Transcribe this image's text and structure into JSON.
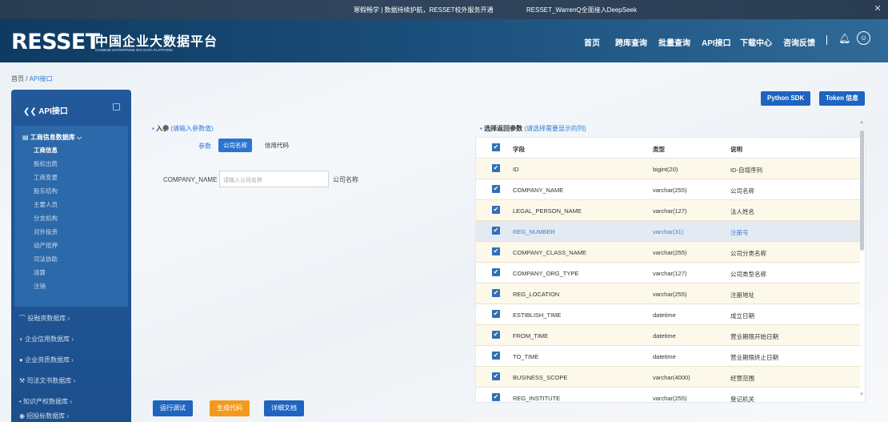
{
  "topbar": {
    "notice": "寒假畅学 | 数据持续护航，RESSET校外服务开通",
    "notice2": "RESSET_WarrenQ全面接入DeepSeek",
    "close": "✕"
  },
  "header": {
    "logo": "RESSET",
    "title_cn": "中国企业大数据平台",
    "title_en": "CHINESE ENTERPRISE BIG DATA PLATFORM",
    "nav": [
      "首页",
      "跨库查询",
      "批量查询",
      "API接口",
      "下载中心",
      "咨询反馈"
    ],
    "bell_icon": "bell-icon",
    "user_icon": "user-icon"
  },
  "breadcrumb": {
    "home": "首页",
    "sep": " / ",
    "current": "API接口"
  },
  "sidebar": {
    "title": "API接口",
    "db_name": "工商信息数据库",
    "items": [
      "工商信息",
      "股权出质",
      "工商变更",
      "股东结构",
      "主要人员",
      "分支机构",
      "对外投资",
      "动产抵押",
      "司法协助",
      "清算",
      "注销"
    ],
    "active_item": "工商信息",
    "categories": [
      "投融资数据库",
      "企业信用数据库",
      "企业资质数据库",
      "司法文书数据库",
      "知识产权数据库",
      "招投标数据库"
    ]
  },
  "toolbar": {
    "python_sdk": "Python SDK",
    "token": "Token 信息"
  },
  "input_section": {
    "title": "入参",
    "hint": "(请输入参数值)",
    "tab_label": "参数",
    "tabs": [
      "公司名称",
      "信用代码"
    ],
    "active_tab": "公司名称",
    "field_label": "COMPANY_NAME",
    "field_placeholder": "请输入公司名称",
    "field_desc": "公司名称"
  },
  "return_section": {
    "title": "选择返回参数",
    "hint": "(请选择需要显示的列)",
    "headers": [
      "字段",
      "类型",
      "说明"
    ],
    "rows": [
      {
        "field": "ID",
        "type": "bigint(20)",
        "desc": "ID-自增序列"
      },
      {
        "field": "COMPANY_NAME",
        "type": "varchar(255)",
        "desc": "公司名称"
      },
      {
        "field": "LEGAL_PERSON_NAME",
        "type": "varchar(127)",
        "desc": "法人姓名"
      },
      {
        "field": "REG_NUMBER",
        "type": "varchar(31)",
        "desc": "注册号"
      },
      {
        "field": "COMPANY_CLASS_NAME",
        "type": "varchar(255)",
        "desc": "公司分类名称"
      },
      {
        "field": "COMPANY_ORG_TYPE",
        "type": "varchar(127)",
        "desc": "公司类型名称"
      },
      {
        "field": "REG_LOCATION",
        "type": "varchar(255)",
        "desc": "注册地址"
      },
      {
        "field": "ESTIBLISH_TIME",
        "type": "datetime",
        "desc": "成立日期"
      },
      {
        "field": "FROM_TIME",
        "type": "datetime",
        "desc": "营业期限开始日期"
      },
      {
        "field": "TO_TIME",
        "type": "datetime",
        "desc": "营业期限终止日期"
      },
      {
        "field": "BUSINESS_SCOPE",
        "type": "varchar(4000)",
        "desc": "经营范围"
      },
      {
        "field": "REG_INSTITUTE",
        "type": "varchar(255)",
        "desc": "登记机关"
      }
    ],
    "highlighted_row": "REG_NUMBER"
  },
  "actions": {
    "run": "运行调试",
    "generate": "生成代码",
    "docs": "详细文档"
  },
  "colors": {
    "primary": "#1e64c0",
    "orange": "#f39a1e",
    "sidebar": "#23599a"
  }
}
